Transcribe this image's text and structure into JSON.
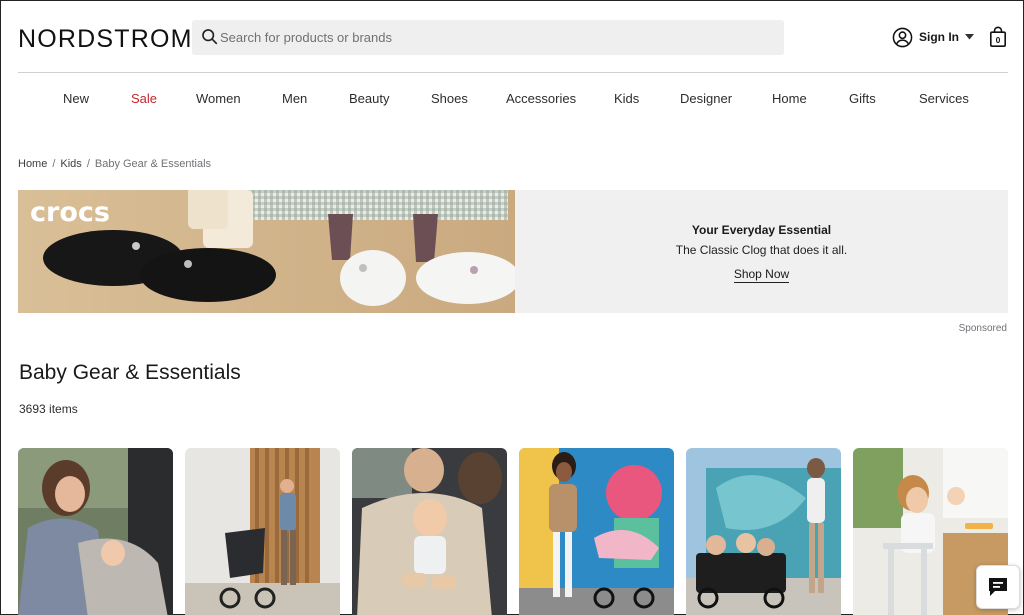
{
  "header": {
    "logo": "NORDSTROM",
    "search_placeholder": "Search for products or brands",
    "signin_label": "Sign In",
    "bag_count": "0"
  },
  "nav": {
    "items": [
      "New",
      "Sale",
      "Women",
      "Men",
      "Beauty",
      "Shoes",
      "Accessories",
      "Kids",
      "Designer",
      "Home",
      "Gifts",
      "Services"
    ],
    "sale_color": "#c2282d"
  },
  "breadcrumb": {
    "home": "Home",
    "kids": "Kids",
    "current": "Baby Gear & Essentials"
  },
  "banner": {
    "brand_logo": "crocs",
    "headline": "Your Everyday Essential",
    "subline": "The Classic Clog that does it all.",
    "cta": "Shop Now",
    "sponsored": "Sponsored"
  },
  "category": {
    "title": "Baby Gear & Essentials",
    "item_count": "3693 items"
  },
  "tiles": [
    {
      "desc": "car-seat-tile"
    },
    {
      "desc": "stroller-tile"
    },
    {
      "desc": "convertible-car-seat-tile"
    },
    {
      "desc": "bassinet-stroller-tile"
    },
    {
      "desc": "wagon-tile"
    },
    {
      "desc": "high-chair-tile"
    }
  ],
  "icons": {
    "search": "search-icon",
    "account": "account-icon",
    "bag": "shopping-bag-icon",
    "chat": "chat-icon"
  }
}
